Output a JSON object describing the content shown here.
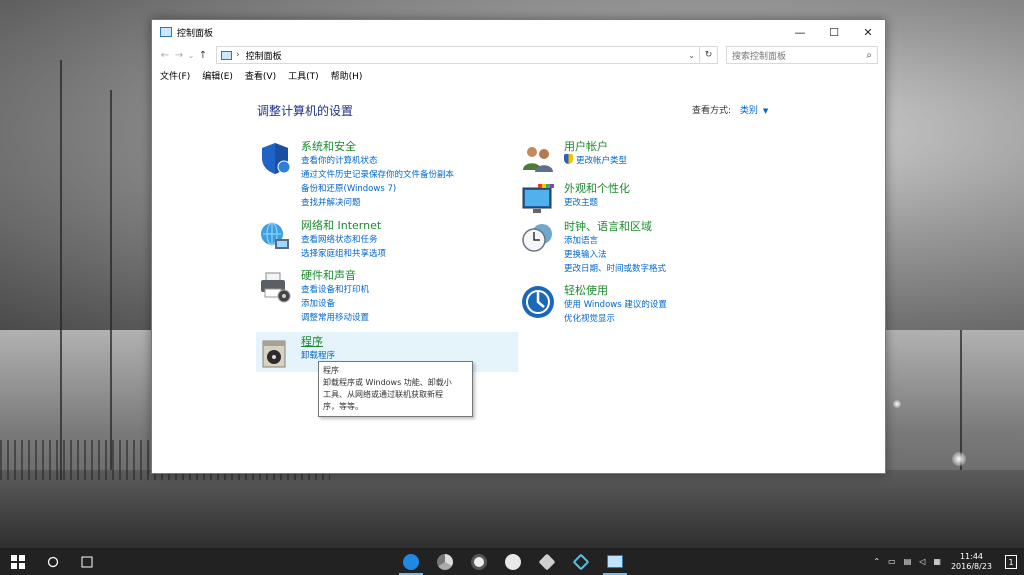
{
  "window": {
    "title": "控制面板",
    "controls": {
      "minimize": "—",
      "maximize": "☐",
      "close": "✕"
    }
  },
  "address": {
    "back": "←",
    "forward": "→",
    "recent": "⌄",
    "up": "↑",
    "separator": "›",
    "path": "控制面板",
    "dropdown": "⌄",
    "refresh": "↻",
    "search_placeholder": "搜索控制面板",
    "search_icon": "⌕"
  },
  "menu": [
    "文件(F)",
    "编辑(E)",
    "查看(V)",
    "工具(T)",
    "帮助(H)"
  ],
  "main": {
    "heading": "调整计算机的设置",
    "view_by_label": "查看方式:",
    "view_by_value": "类别",
    "view_by_arrow": "▼"
  },
  "categories_left": [
    {
      "title": "系统和安全",
      "links": [
        "查看你的计算机状态",
        "通过文件历史记录保存你的文件备份副本",
        "备份和还原(Windows 7)",
        "查找并解决问题"
      ]
    },
    {
      "title": "网络和 Internet",
      "links": [
        "查看网络状态和任务",
        "选择家庭组和共享选项"
      ]
    },
    {
      "title": "硬件和声音",
      "links": [
        "查看设备和打印机",
        "添加设备",
        "调整常用移动设置"
      ]
    },
    {
      "title": "程序",
      "links": [
        "卸载程序"
      ]
    }
  ],
  "categories_right": [
    {
      "title": "用户帐户",
      "links": [
        "更改帐户类型"
      ]
    },
    {
      "title": "外观和个性化",
      "links": [
        "更改主题"
      ]
    },
    {
      "title": "时钟、语言和区域",
      "links": [
        "添加语言",
        "更换输入法",
        "更改日期、时间或数字格式"
      ]
    },
    {
      "title": "轻松使用",
      "links": [
        "使用 Windows 建议的设置",
        "优化视觉显示"
      ]
    }
  ],
  "tooltip": {
    "title": "程序",
    "lines": [
      "卸载程序或 Windows 功能、卸载小",
      "工具、从网络或通过联机获取新程",
      "序，等等。"
    ]
  },
  "taskbar": {
    "clock_time": "11:44",
    "clock_date": "2016/8/23",
    "notification_count": "1"
  },
  "colors": {
    "accent": "#1aa1a0",
    "link": "#0066cc",
    "category_title": "#1b8a2e",
    "heading": "#1e3287"
  }
}
